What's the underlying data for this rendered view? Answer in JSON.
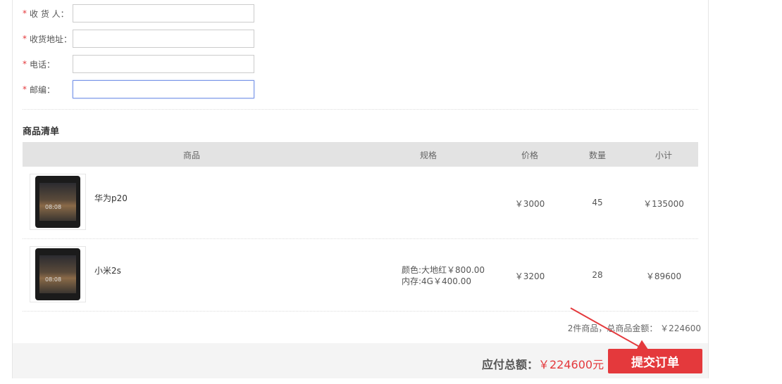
{
  "form": {
    "required_mark": "*",
    "fields": [
      {
        "label": "收 货 人：",
        "value": "",
        "placeholder": ""
      },
      {
        "label": "收货地址：",
        "value": "",
        "placeholder": ""
      },
      {
        "label": "电话：",
        "value": "",
        "placeholder": ""
      },
      {
        "label": "邮编：",
        "value": "",
        "placeholder": ""
      }
    ]
  },
  "goods": {
    "title": "商品清单",
    "headers": {
      "product": "商品",
      "spec": "规格",
      "price": "价格",
      "qty": "数量",
      "subtotal": "小计"
    },
    "items": [
      {
        "name": "华为p20",
        "spec1": "",
        "spec2": "",
        "price": "￥3000",
        "qty": "45",
        "subtotal": "￥135000",
        "clock": "08:08"
      },
      {
        "name": "小米2s",
        "spec1": "颜色:大地红￥800.00",
        "spec2": "内存:4G￥400.00",
        "price": "￥3200",
        "qty": "28",
        "subtotal": "￥89600",
        "clock": "08:08"
      }
    ],
    "summary": "2件商品，总商品金额： ￥224600"
  },
  "footer": {
    "total_label": "应付总额：",
    "total_value": "￥224600元",
    "submit_label": "提交订单"
  },
  "colors": {
    "accent": "#e4393c",
    "annotation_arrow": "#e4393c"
  }
}
